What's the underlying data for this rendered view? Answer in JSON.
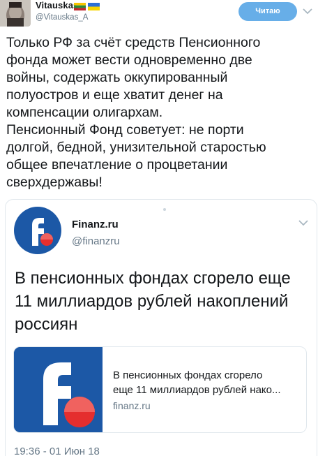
{
  "user": {
    "display_name": "Vitauskas",
    "handle": "@Vitauskas_A",
    "flags": [
      "lithuania-flag",
      "ukraine-flag"
    ]
  },
  "follow_button": {
    "label": "Читаю"
  },
  "tweet": {
    "text": "Только РФ за счёт средств Пенсионного\nфонда может вести одновременно две\nвойны, содержать оккупированный\nполуостров и еще хватит денег на\nкомпенсации олигархам.\nПенсионный Фонд советует: не порти\nдолгой, бедной, унизительной старостью\nобщее впечатление о процветании\nсверхдержавы!"
  },
  "quoted_tweet": {
    "name": "Finanz.ru",
    "handle": "@finanzru",
    "text": "В пенсионных фондах сгорело еще 11 миллиардов рублей накоплений россиян",
    "link_card": {
      "title": "В пенсионных фондах сгорело\nеще 11 миллиардов рублей нако...",
      "domain": "finanz.ru"
    },
    "timestamp": "19:36 - 01 Июн 18"
  },
  "colors": {
    "follow_button_bg": "#67aee8",
    "finanz_blue": "#1c58a6",
    "finanz_red": "#e52e2e",
    "secondary_text": "#657786"
  },
  "icons": {
    "avatar": "lincoln-avatar",
    "chevron": "chevron-down-icon",
    "finanz_logo": "finanz-logo"
  }
}
